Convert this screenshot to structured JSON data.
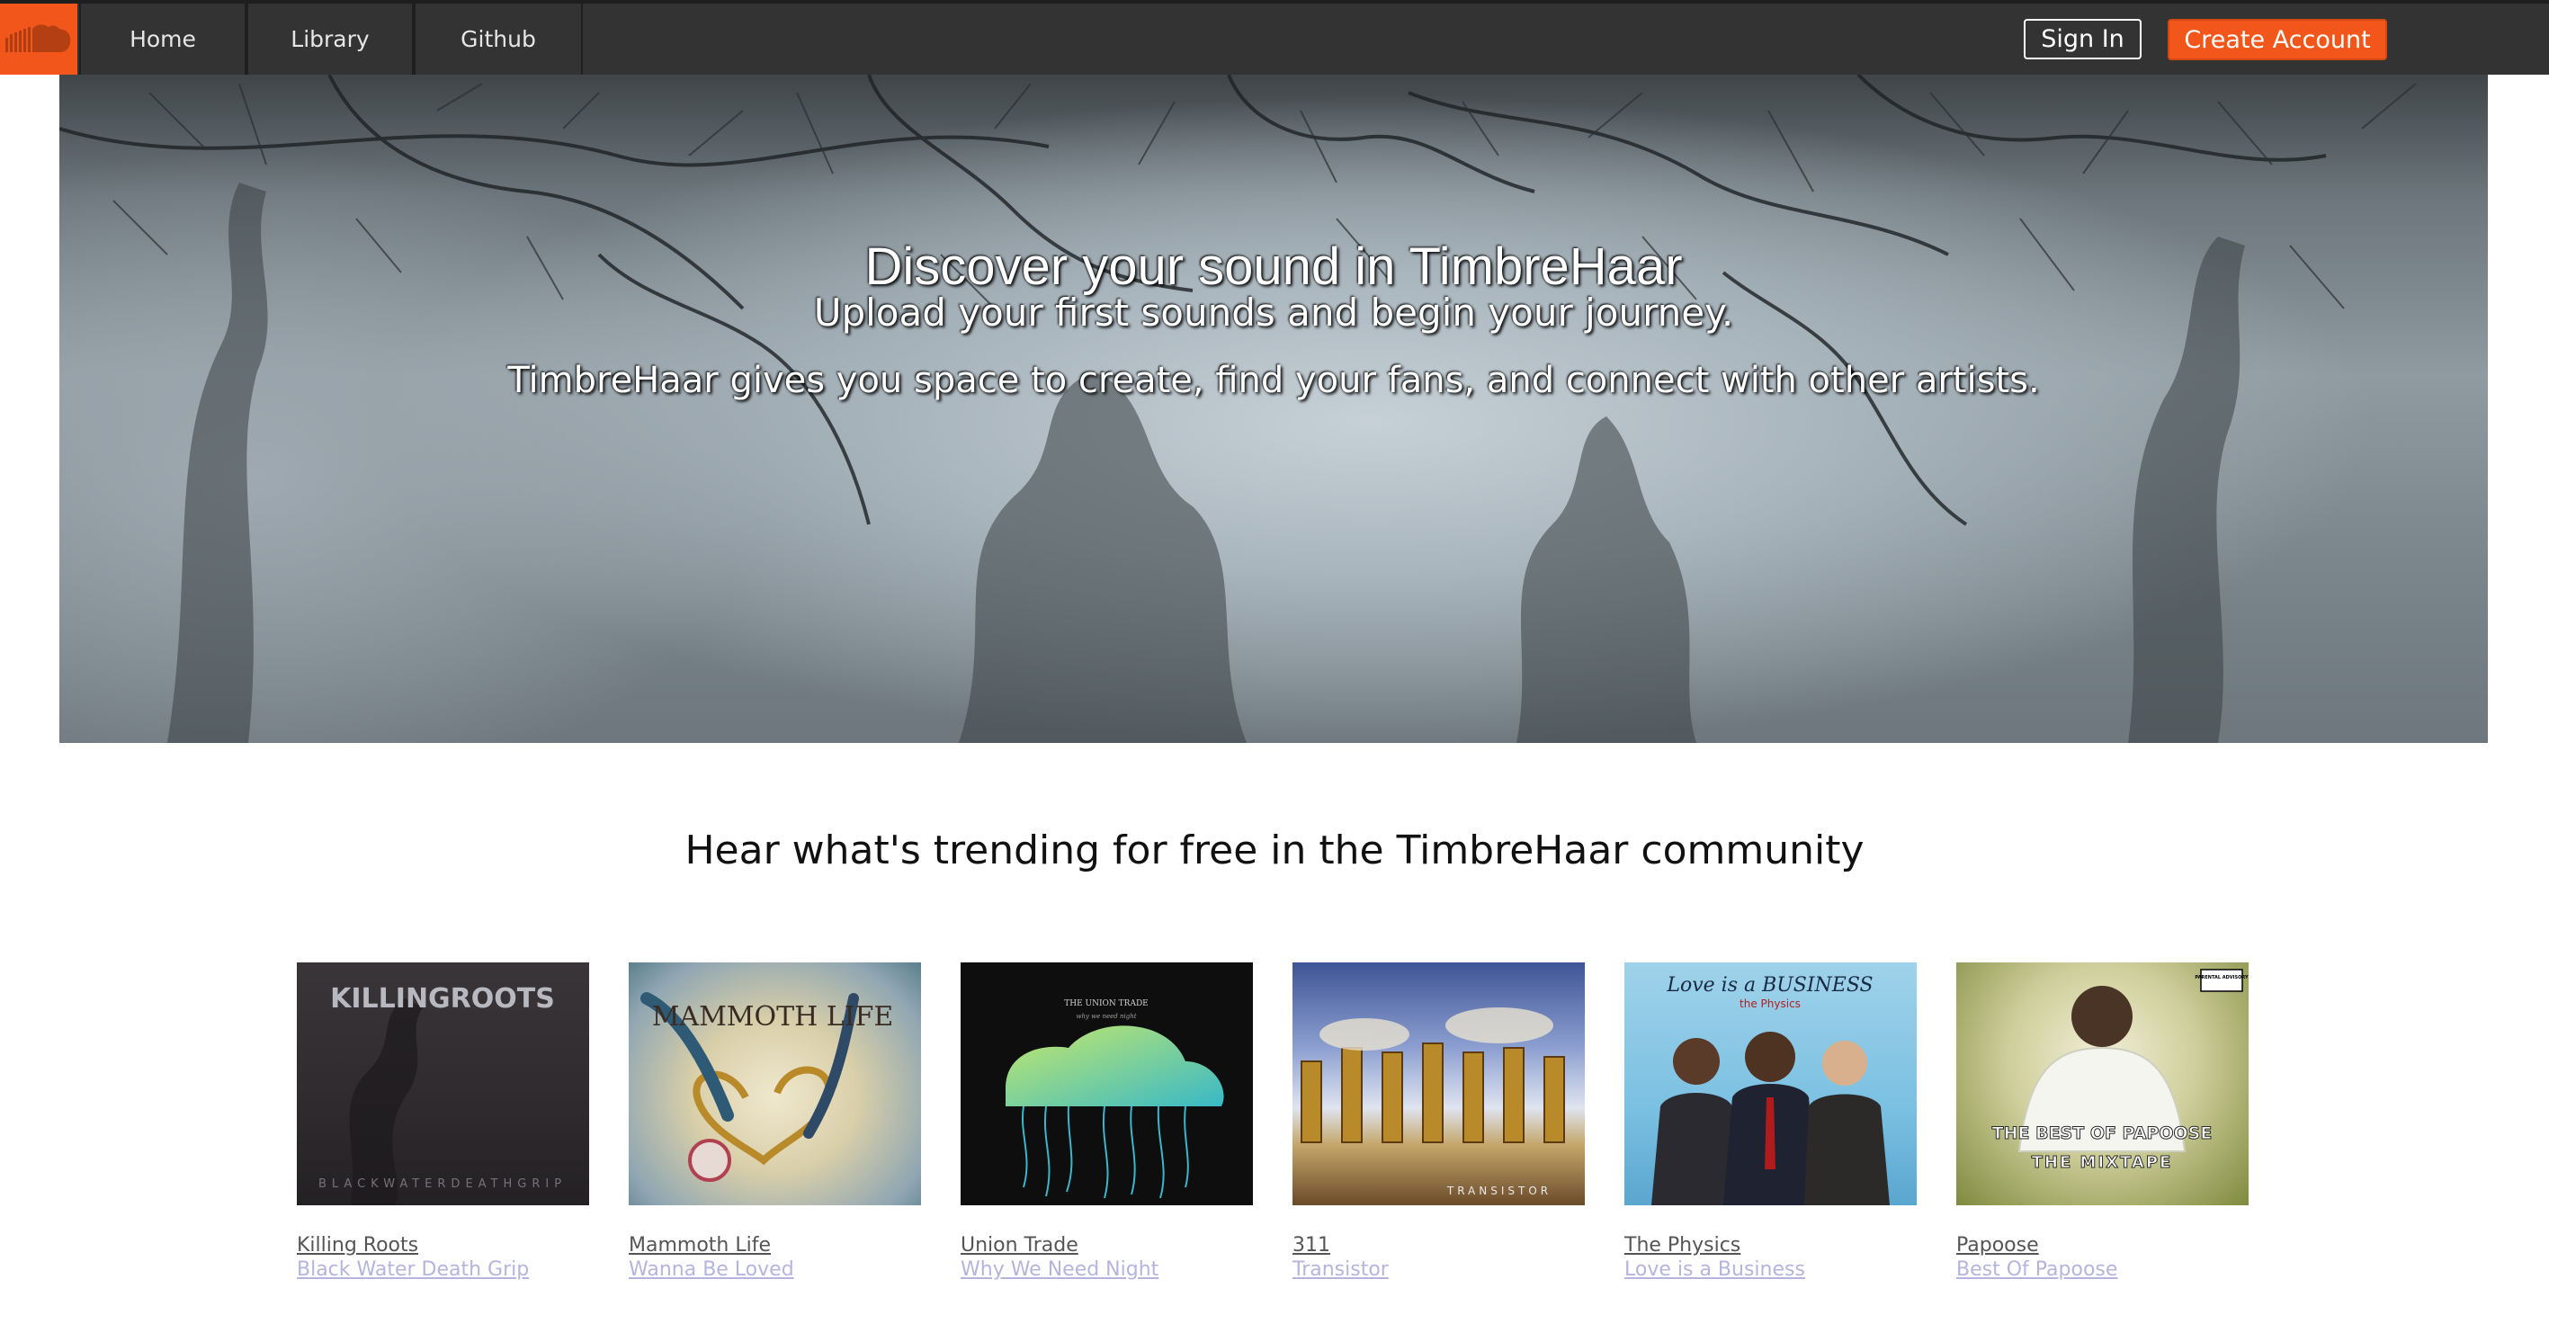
{
  "nav": {
    "logo_icon": "soundcloud-cloud-icon",
    "items": [
      {
        "label": "Home"
      },
      {
        "label": "Library"
      },
      {
        "label": "Github"
      }
    ],
    "sign_in": "Sign In",
    "create_account": "Create Account"
  },
  "hero": {
    "title": "Discover your sound in TimbreHaar",
    "subtitle": "Upload your first sounds and begin your journey.",
    "description": "TimbreHaar gives you space to create, find your fans, and connect with other artists."
  },
  "trending": {
    "heading": "Hear what's trending for free in the TimbreHaar community",
    "albums": [
      {
        "artist": "Killing Roots",
        "song": "Black Water Death Grip",
        "cover_text": "KILLINGROOTS",
        "cover_subtext": "BLACKWATERDEATHGRIP"
      },
      {
        "artist": "Mammoth Life",
        "song": "Wanna Be Loved",
        "cover_text": "MAMMOTH LIFE"
      },
      {
        "artist": "Union Trade",
        "song": "Why We Need Night",
        "cover_text": "THE UNION TRADE",
        "cover_subtext": "why we need night"
      },
      {
        "artist": "311",
        "song": "Transistor",
        "cover_text": "TRANSISTOR"
      },
      {
        "artist": "The Physics",
        "song": "Love is a Business",
        "cover_text": "Love is a BUSINESS",
        "cover_subtext": "the Physics"
      },
      {
        "artist": "Papoose",
        "song": "Best Of Papoose",
        "cover_text": "THE BEST OF PAPOOSE",
        "cover_subtext": "THE MIXTAPE",
        "badge": "PARENTAL ADVISORY"
      }
    ]
  },
  "colors": {
    "brand_orange": "#f2561a",
    "nav_bg": "#333333",
    "song_link": "#b4b4dc"
  }
}
